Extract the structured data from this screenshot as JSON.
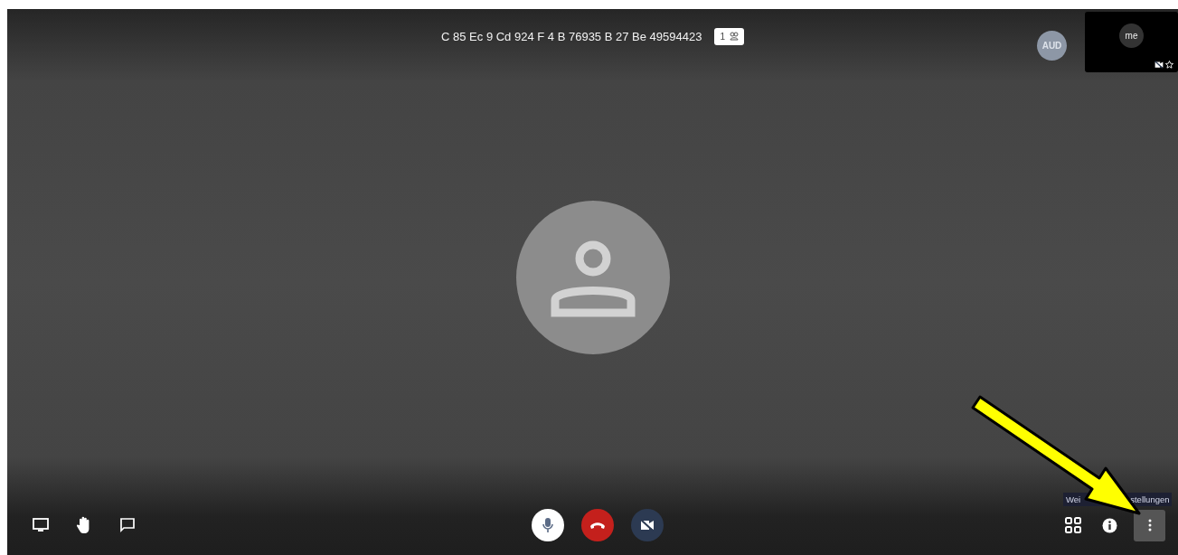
{
  "meeting": {
    "title": "C 85 Ec 9 Cd 924 F 4 B 76935 B 27 Be 49594423",
    "participant_count": "1"
  },
  "participants": [
    {
      "initials": "AUD"
    }
  ],
  "self_tile": {
    "label": "me",
    "camera_on": false
  },
  "controls": {
    "microphone_on": true,
    "camera_on": false
  },
  "tooltip": {
    "parts": [
      "Wei",
      "stellungen"
    ]
  }
}
